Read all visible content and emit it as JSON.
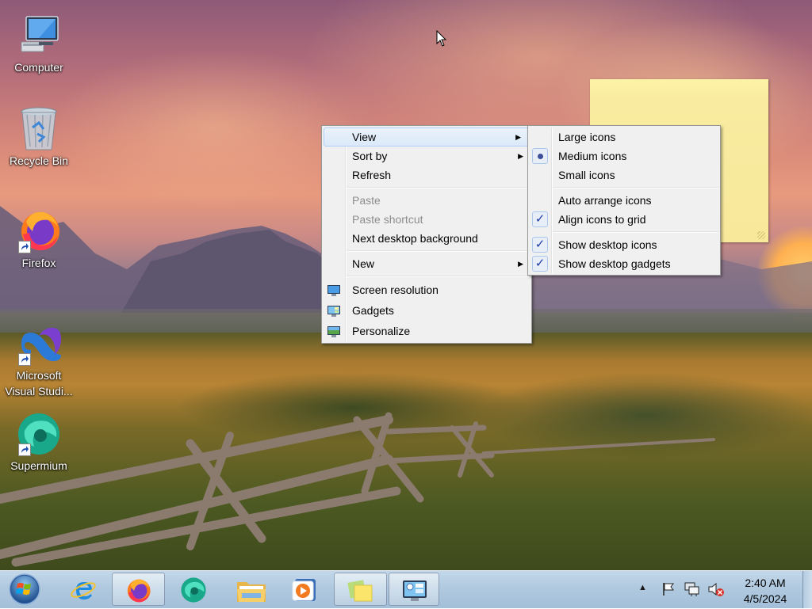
{
  "desktop": {
    "icons": [
      {
        "label": "Computer",
        "icon": "computer-icon",
        "shortcut": false
      },
      {
        "label": "Recycle Bin",
        "icon": "recycle-bin-icon",
        "shortcut": false
      },
      {
        "label": "Firefox",
        "icon": "firefox-icon",
        "shortcut": true
      },
      {
        "label": "Microsoft Visual Studi...",
        "label_line1": "Microsoft",
        "label_line2": "Visual Studi...",
        "icon": "visual-studio-icon",
        "shortcut": true
      },
      {
        "label": "Supermium",
        "icon": "supermium-icon",
        "shortcut": true
      }
    ]
  },
  "context_menu": {
    "items": [
      {
        "label": "View",
        "submenu": true,
        "highlighted": true
      },
      {
        "label": "Sort by",
        "submenu": true
      },
      {
        "label": "Refresh"
      },
      {
        "label": "Paste",
        "disabled": true
      },
      {
        "label": "Paste shortcut",
        "disabled": true
      },
      {
        "label": "Next desktop background"
      },
      {
        "label": "New",
        "submenu": true
      },
      {
        "label": "Screen resolution",
        "icon": "screen-resolution-icon"
      },
      {
        "label": "Gadgets",
        "icon": "gadgets-icon"
      },
      {
        "label": "Personalize",
        "icon": "personalize-icon"
      }
    ]
  },
  "view_submenu": {
    "items": [
      {
        "label": "Large icons",
        "state": "none"
      },
      {
        "label": "Medium icons",
        "state": "radio-selected"
      },
      {
        "label": "Small icons",
        "state": "none"
      },
      {
        "label": "Auto arrange icons",
        "state": "none"
      },
      {
        "label": "Align icons to grid",
        "state": "checked"
      },
      {
        "label": "Show desktop icons",
        "state": "checked"
      },
      {
        "label": "Show desktop gadgets",
        "state": "checked"
      }
    ],
    "check_glyph": "✓"
  },
  "taskbar": {
    "apps": [
      {
        "name": "internet-explorer",
        "active": false
      },
      {
        "name": "firefox",
        "active": true
      },
      {
        "name": "supermium",
        "active": false
      },
      {
        "name": "file-explorer",
        "active": false
      },
      {
        "name": "media-player",
        "active": false
      },
      {
        "name": "sticky-notes",
        "active": true
      },
      {
        "name": "gadgets",
        "active": true
      }
    ],
    "clock": {
      "time": "2:40 AM",
      "date": "4/5/2024"
    }
  },
  "colors": {
    "menu_bg": "#f0f0f0",
    "highlight_border": "#aecff7",
    "taskbar": "#b0c9df",
    "note": "#f9eca0"
  }
}
